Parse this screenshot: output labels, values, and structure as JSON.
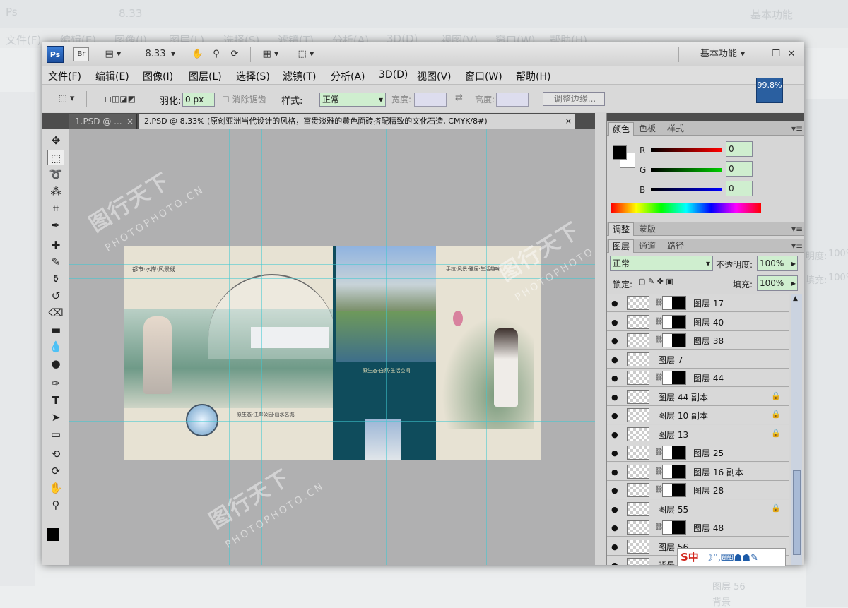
{
  "bg": {
    "menu": [
      "文件(F)",
      "编辑(E)",
      "图像(I)",
      "图层(L)",
      "选择(S)",
      "滤镜(T)",
      "分析(A)",
      "3D(D)",
      "视图(V)",
      "窗口(W)",
      "帮助(H)"
    ],
    "workspace": "基本功能",
    "zoom": "8.33",
    "layer_name": "图层 56",
    "bottom_label": "背景",
    "opacity_label": "明度:",
    "opacity_value": "100%",
    "fill_label": "填充:",
    "fill_value": "100%"
  },
  "window": {
    "app_logo": "Ps",
    "bridge": "Br",
    "zoom": "8.33",
    "workspace": "基本功能",
    "badge": "99.8%"
  },
  "menu": [
    "文件(F)",
    "编辑(E)",
    "图像(I)",
    "图层(L)",
    "选择(S)",
    "滤镜(T)",
    "分析(A)",
    "3D(D)",
    "视图(V)",
    "窗口(W)",
    "帮助(H)"
  ],
  "options": {
    "feather_label": "羽化:",
    "feather_value": "0 px",
    "antialias_label": "消除锯齿",
    "style_label": "样式:",
    "style_value": "正常",
    "width_label": "宽度:",
    "height_label": "高度:",
    "refine_button": "调整边缘..."
  },
  "tabs": [
    {
      "label": "1.PSD @ ...",
      "close": "×"
    },
    {
      "label": "2.PSD @ 8.33% (原创亚洲当代设计的风格，富贵淡雅的黄色面砖搭配精致的文化石造, CMYK/8#)",
      "close": "×"
    }
  ],
  "watermark": {
    "cn": "图行天下",
    "en": "PHOTOPHOTO.CN"
  },
  "document": {
    "text1": "都市·水岸·风景线",
    "text2": "原生态·江岸公园·山水名城",
    "text3": "原生态·自然·生活空间",
    "text4": "手拉·风景·雅居·生活趣味"
  },
  "color_panel": {
    "tabs": [
      "颜色",
      "色板",
      "样式"
    ],
    "r_label": "R",
    "g_label": "G",
    "b_label": "B",
    "r": "0",
    "g": "0",
    "b": "0"
  },
  "adjust_panel": {
    "tabs": [
      "调整",
      "蒙版"
    ]
  },
  "layers_panel": {
    "tabs": [
      "图层",
      "通道",
      "路径"
    ],
    "blend_mode": "正常",
    "opacity_label": "不透明度:",
    "opacity": "100%",
    "lock_label": "锁定:",
    "fill_label": "填充:",
    "fill": "100%",
    "layers": [
      {
        "name": "图层 17",
        "mask": true,
        "locked": false
      },
      {
        "name": "图层 40",
        "mask": true,
        "locked": false
      },
      {
        "name": "图层 38",
        "mask": true,
        "locked": false
      },
      {
        "name": "图层 7",
        "mask": false,
        "locked": false
      },
      {
        "name": "图层 44",
        "mask": true,
        "locked": false
      },
      {
        "name": "图层 44 副本",
        "mask": false,
        "locked": true
      },
      {
        "name": "图层 10 副本",
        "mask": false,
        "locked": true
      },
      {
        "name": "图层 13",
        "mask": false,
        "locked": true
      },
      {
        "name": "图层 25",
        "mask": true,
        "locked": false
      },
      {
        "name": "图层 16 副本",
        "mask": true,
        "locked": false
      },
      {
        "name": "图层 28",
        "mask": true,
        "locked": false
      },
      {
        "name": "图层 55",
        "mask": false,
        "locked": true
      },
      {
        "name": "图层 48",
        "mask": true,
        "locked": false
      },
      {
        "name": "图层 56",
        "mask": false,
        "locked": false
      },
      {
        "name": "背景",
        "mask": false,
        "locked": false
      }
    ]
  },
  "ime": {
    "label": "S中",
    "icons": "☽°,⌨☗☗✎"
  },
  "colors": {
    "accent": "#2a5fa0",
    "field_green": "#cfeecf"
  }
}
